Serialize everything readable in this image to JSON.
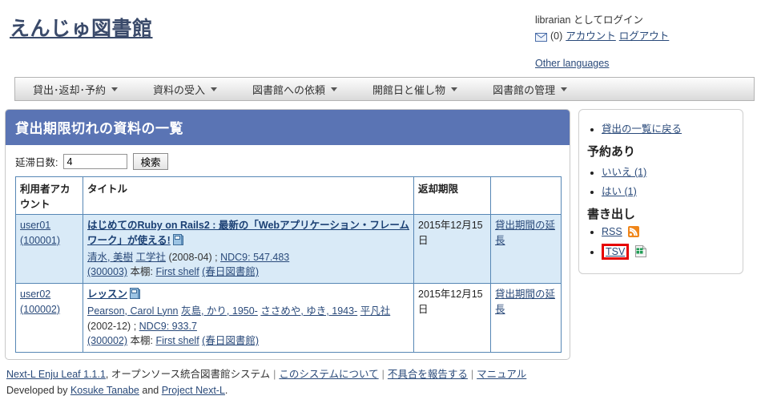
{
  "header": {
    "site_title": "えんじゅ図書館",
    "login_status": "librarian としてログイン",
    "mail_icon": "envelope-icon",
    "message_count": "(0)",
    "account_link": "アカウント",
    "logout_link": "ログアウト",
    "other_languages": "Other languages"
  },
  "nav": {
    "items": [
      {
        "label": "貸出･返却･予約"
      },
      {
        "label": "資料の受入"
      },
      {
        "label": "図書館への依頼"
      },
      {
        "label": "開館日と催し物"
      },
      {
        "label": "図書館の管理"
      }
    ]
  },
  "main": {
    "panel_title": "貸出期限切れの資料の一覧",
    "search": {
      "label": "延滞日数:",
      "value": "4",
      "button": "検索"
    },
    "table": {
      "headers": [
        "利用者アカウント",
        "タイトル",
        "返却期限",
        ""
      ],
      "rows": [
        {
          "account_user": "user01",
          "account_id": "(100001)",
          "title": "はじめてのRuby on Rails2 : 最新の「Webアプリケーション・フレームワーク」が使える!",
          "title_icon": "book-icon",
          "author": "清水, 美樹",
          "publisher": "工学社",
          "pubdate": "(2008-04)",
          "separator": ";",
          "ndc": "NDC9: 547.483",
          "item_id": "(300003)",
          "shelf_label": "本棚:",
          "shelf": "First shelf",
          "library": "(春日図書館)",
          "due_date": "2015年12月15日",
          "action": "貸出期間の延長"
        },
        {
          "account_user": "user02",
          "account_id": "(100002)",
          "title": "レッスン",
          "title_icon": "book-icon",
          "author": "Pearson, Carol Lynn",
          "author2": "灰島, かり, 1950-",
          "author3": "ささめや, ゆき, 1943-",
          "publisher": "平凡社",
          "pubdate": "(2002-12)",
          "separator": ";",
          "ndc": "NDC9: 933.7",
          "item_id": "(300002)",
          "shelf_label": "本棚:",
          "shelf": "First shelf",
          "library": "(春日図書館)",
          "due_date": "2015年12月15日",
          "action": "貸出期間の延長"
        }
      ]
    }
  },
  "sidebar": {
    "back_link": "貸出の一覧に戻る",
    "reserved_heading": "予約あり",
    "reserved_items": [
      {
        "label": "いいえ (1)"
      },
      {
        "label": "はい (1)"
      }
    ],
    "export_heading": "書き出し",
    "export_items": [
      {
        "label": "RSS",
        "icon": "rss-icon",
        "highlighted": false
      },
      {
        "label": "TSV",
        "icon": "spreadsheet-icon",
        "highlighted": true
      }
    ]
  },
  "footer": {
    "app_name": "Next-L Enju Leaf 1.1.1",
    "tagline": ", オープンソース統合図書館システム",
    "about_link": "このシステムについて",
    "bug_link": "不具合を報告する",
    "manual_link": "マニュアル",
    "developed_by": "Developed by",
    "developer": "Kosuke Tanabe",
    "and": "and",
    "project": "Project Next-L",
    "period": "."
  },
  "colors": {
    "panel_title_bg": "#5a74b4",
    "table_border": "#5787b5",
    "row_highlight": "#d9eaf7",
    "highlight_box": "#e60000",
    "rss_orange": "#f0861a"
  }
}
